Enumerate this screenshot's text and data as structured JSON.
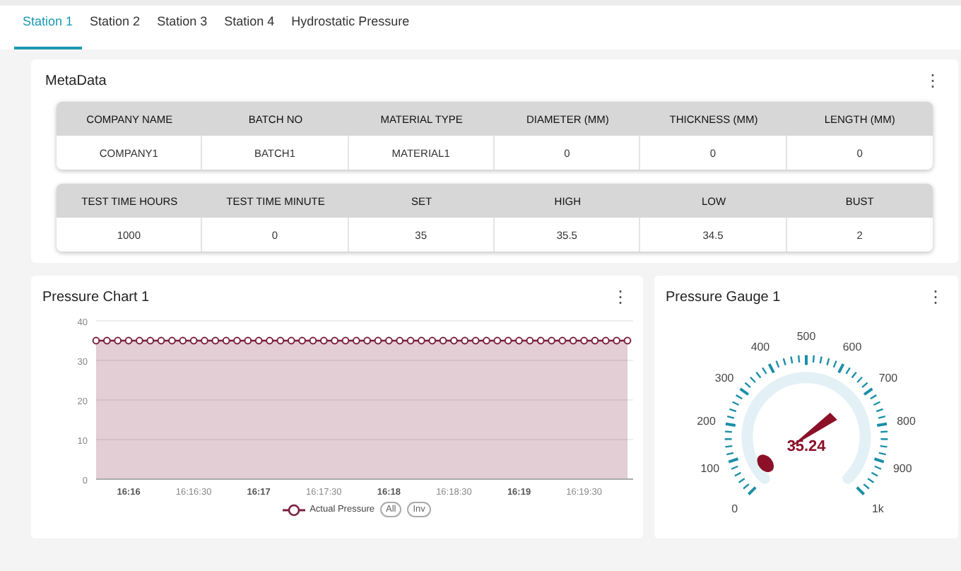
{
  "tabs": [
    {
      "label": "Station 1",
      "selected": true
    },
    {
      "label": "Station 2",
      "selected": false
    },
    {
      "label": "Station 3",
      "selected": false
    },
    {
      "label": "Station 4",
      "selected": false
    },
    {
      "label": "Hydrostatic Pressure",
      "selected": false
    }
  ],
  "metadata": {
    "title": "MetaData",
    "menu_icon": "⋮",
    "tables": [
      {
        "columns": [
          "COMPANY NAME",
          "BATCH NO",
          "MATERIAL TYPE",
          "DIAMETER (MM)",
          "THICKNESS (MM)",
          "LENGTH (MM)"
        ],
        "row": [
          "COMPANY1",
          "BATCH1",
          "MATERIAL1",
          "0",
          "0",
          "0"
        ]
      },
      {
        "columns": [
          "TEST TIME HOURS",
          "TEST TIME MINUTE",
          "SET",
          "HIGH",
          "LOW",
          "BUST"
        ],
        "row": [
          "1000",
          "0",
          "35",
          "35.5",
          "34.5",
          "2"
        ]
      }
    ]
  },
  "pressure_chart": {
    "title": "Pressure Chart 1",
    "legend_buttons": [
      "All",
      "Inv"
    ],
    "chart_data": {
      "type": "area",
      "categories": [
        null,
        null,
        null,
        "16:16",
        null,
        null,
        null,
        null,
        null,
        "16:16:30",
        null,
        null,
        null,
        null,
        null,
        "16:17",
        null,
        null,
        null,
        null,
        null,
        "16:17:30",
        null,
        null,
        null,
        null,
        null,
        "16:18",
        null,
        null,
        null,
        null,
        null,
        "16:18:30",
        null,
        null,
        null,
        null,
        null,
        "16:19",
        null,
        null,
        null,
        null,
        null,
        "16:19:30",
        null,
        null,
        null,
        null
      ],
      "series": [
        {
          "name": "Actual Pressure",
          "color": "#7a1f3d",
          "values": [
            35,
            35,
            35,
            35,
            35,
            35,
            35,
            35,
            35,
            35,
            35,
            35,
            35,
            35,
            35,
            35,
            35,
            35,
            35,
            35,
            35,
            35,
            35,
            35,
            35,
            35,
            35,
            35,
            35,
            35,
            35,
            35,
            35,
            35,
            35,
            35,
            35,
            35,
            35,
            35,
            35,
            35,
            35,
            35,
            35,
            35,
            35,
            35,
            35,
            35
          ]
        }
      ],
      "ylim": [
        0,
        40
      ],
      "yticks": [
        0,
        10,
        20,
        30,
        40
      ],
      "grid": true
    },
    "menu_icon": "⋮"
  },
  "pressure_gauge": {
    "title": "Pressure Gauge 1",
    "menu_icon": "⋮",
    "value": "35.24",
    "scale_labels": [
      "0",
      "100",
      "200",
      "300",
      "400",
      "500",
      "600",
      "700",
      "800",
      "900",
      "1k"
    ]
  }
}
